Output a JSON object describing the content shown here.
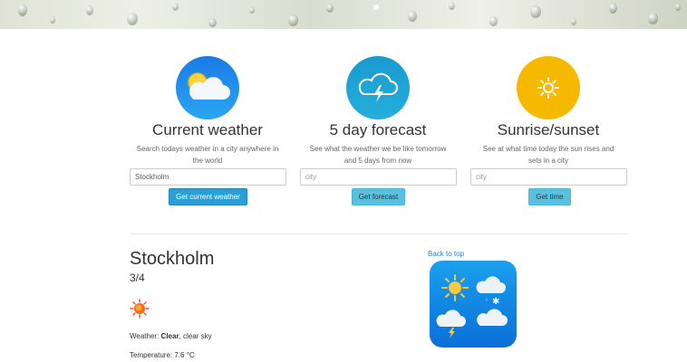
{
  "features": [
    {
      "title": "Current weather",
      "description": "Search todays weather in a city anywhere in the world",
      "input_value": "Stockholm",
      "input_placeholder": "",
      "button_label": "Get current weather",
      "icon": "cloud-sun-icon",
      "color": "#1e90e8"
    },
    {
      "title": "5 day forecast",
      "description": "See what the weather we be like tomorrow and 5 days from now",
      "input_value": "",
      "input_placeholder": "city",
      "button_label": "Get forecast",
      "icon": "storm-cloud-icon",
      "color": "#1fa3cf"
    },
    {
      "title": "Sunrise/sunset",
      "description": "See at what time today the sun rises and sets in a city",
      "input_value": "",
      "input_placeholder": "city",
      "button_label": "Get time",
      "icon": "sun-icon",
      "color": "#f5b800"
    }
  ],
  "result": {
    "city": "Stockholm",
    "date": "3/4",
    "weather_label": "Weather: ",
    "weather_main": "Clear",
    "weather_desc": ", clear sky",
    "temperature": "Temperature: 7.6 °C"
  },
  "back_to_top": "Back to top",
  "icons": {
    "result_icon": "sun-icon",
    "app_icon": "weather-app-icon"
  }
}
